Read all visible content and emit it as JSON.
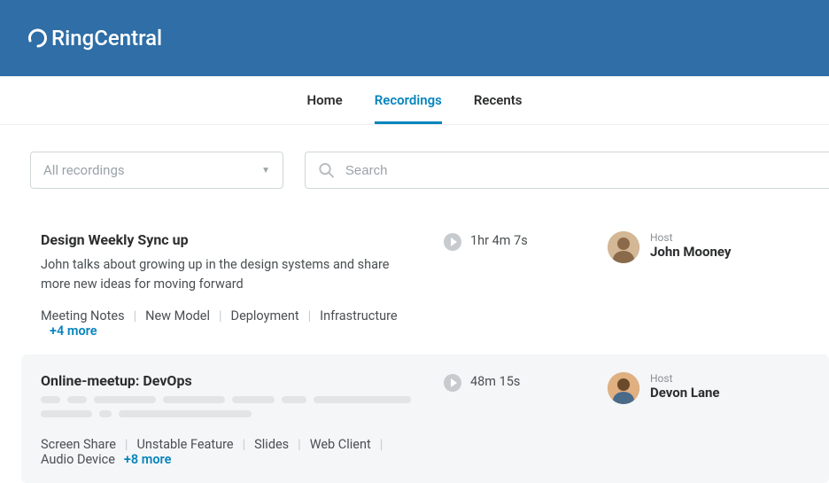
{
  "brand": "RingCentral",
  "nav": {
    "home": "Home",
    "recordings": "Recordings",
    "recents": "Recents"
  },
  "filter": {
    "selected": "All recordings"
  },
  "search": {
    "placeholder": "Search"
  },
  "recordings": [
    {
      "title": "Design Weekly Sync up",
      "description": "John talks about growing up in the design systems and share more new ideas for moving forward",
      "tags": [
        "Meeting Notes",
        "New Model",
        "Deployment",
        "Infrastructure"
      ],
      "more_tags": "+4 more",
      "duration": "1hr 4m 7s",
      "host_label": "Host",
      "host_name": "John Mooney"
    },
    {
      "title": "Online-meetup: DevOps",
      "tags": [
        "Screen Share",
        "Unstable Feature",
        "Slides",
        "Web Client",
        "Audio Device"
      ],
      "more_tags": "+8 more",
      "duration": "48m 15s",
      "host_label": "Host",
      "host_name": "Devon Lane"
    }
  ]
}
